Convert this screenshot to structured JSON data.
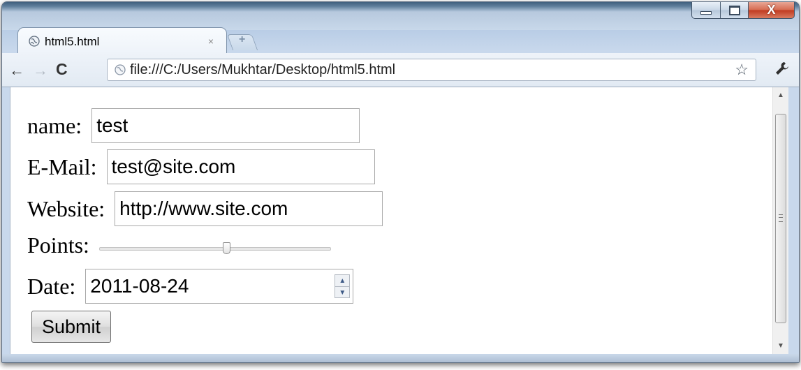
{
  "window": {
    "controls": {
      "minimize_icon": "minimize-icon",
      "maximize_icon": "maximize-icon",
      "close_glyph": "X"
    }
  },
  "tab": {
    "title": "html5.html",
    "close": "×",
    "new_tab": "+"
  },
  "toolbar": {
    "back": "←",
    "forward": "→",
    "reload": "C",
    "url": "file:///C:/Users/Mukhtar/Desktop/html5.html",
    "bookmark": "☆",
    "wrench": "🔧"
  },
  "form": {
    "name": {
      "label": "name:",
      "value": "test"
    },
    "email": {
      "label": "E-Mail:",
      "value": "test@site.com"
    },
    "website": {
      "label": "Website:",
      "value": "http://www.site.com"
    },
    "points": {
      "label": "Points:",
      "level": 0.55
    },
    "date": {
      "label": "Date:",
      "value": "2011-08-24",
      "up": "▲",
      "down": "▼"
    },
    "submit_label": "Submit"
  },
  "scrollbar": {
    "up": "▲",
    "down": "▼"
  }
}
